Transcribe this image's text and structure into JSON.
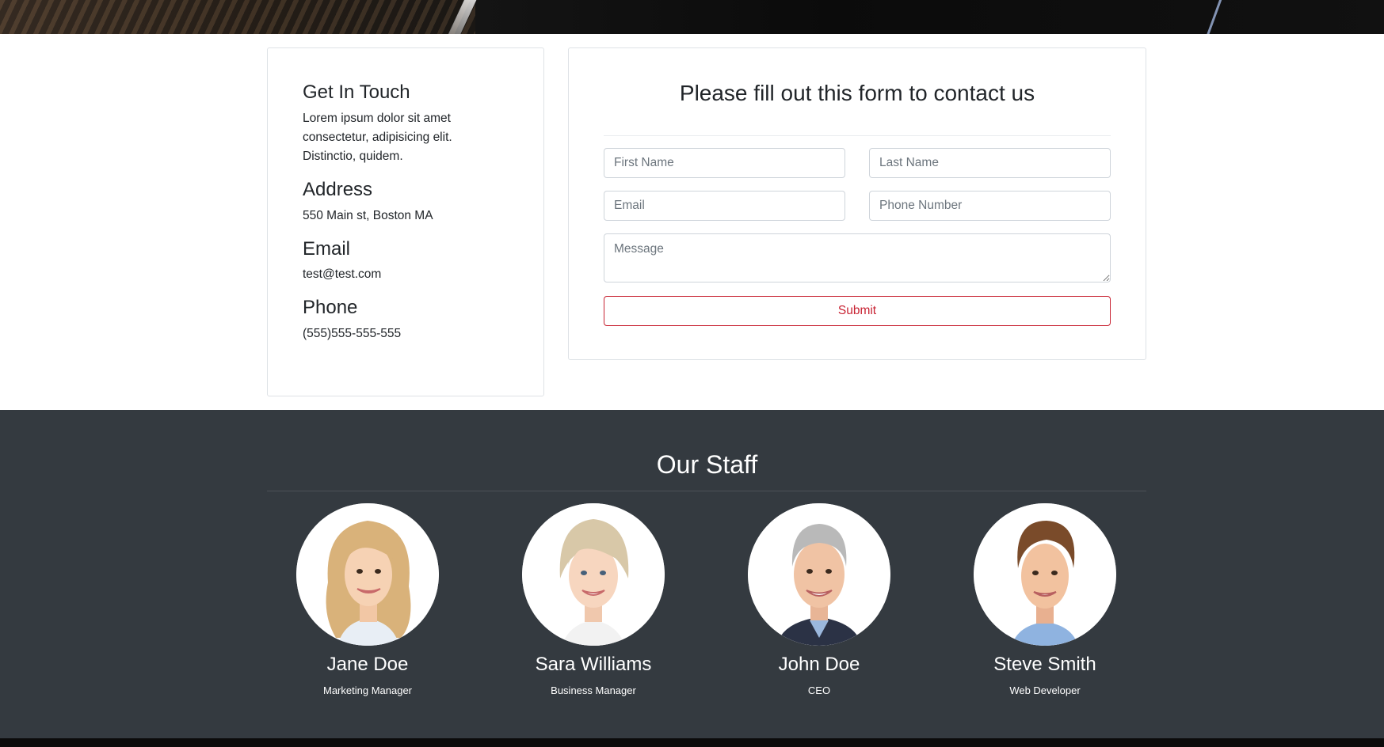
{
  "contact_info": {
    "heading": "Get In Touch",
    "intro": "Lorem ipsum dolor sit amet consectetur, adipisicing elit. Distinctio, quidem.",
    "address_heading": "Address",
    "address": "550 Main st, Boston MA",
    "email_heading": "Email",
    "email": "test@test.com",
    "phone_heading": "Phone",
    "phone": "(555)555-555-555"
  },
  "contact_form": {
    "title": "Please fill out this form to contact us",
    "first_name_placeholder": "First Name",
    "last_name_placeholder": "Last Name",
    "email_placeholder": "Email",
    "phone_placeholder": "Phone Number",
    "message_placeholder": "Message",
    "submit_label": "Submit",
    "accent_color": "#c82333"
  },
  "staff": {
    "title": "Our Staff",
    "background_color": "#343a40",
    "members": [
      {
        "name": "Jane Doe",
        "role": "Marketing Manager",
        "hair_color": "#d9b27a",
        "suit_color": "#e8eef5"
      },
      {
        "name": "Sara Williams",
        "role": "Business Manager",
        "hair_color": "#d8c8a8",
        "suit_color": "#f2f2f2"
      },
      {
        "name": "John Doe",
        "role": "CEO",
        "hair_color": "#b9b9b9",
        "suit_color": "#2b3245"
      },
      {
        "name": "Steve Smith",
        "role": "Web Developer",
        "hair_color": "#7a4b2a",
        "suit_color": "#8fb3e0"
      }
    ]
  }
}
